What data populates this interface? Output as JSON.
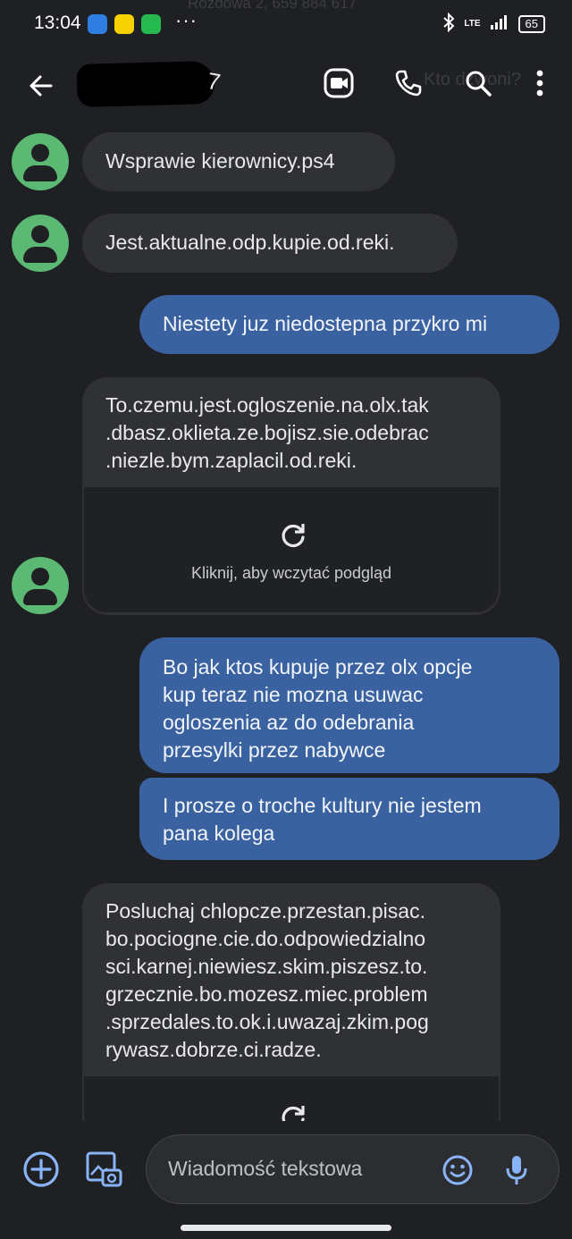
{
  "status_bar": {
    "time": "13:04",
    "dots": "···",
    "network": "LTE",
    "battery": "65",
    "background_caller_text": "Rozdowa 2, 659 884 617"
  },
  "app_bar": {
    "contact_name_suffix": "7",
    "background_search_text": "Kto dzwoni?",
    "icons": [
      "back-arrow-icon",
      "video-call-icon",
      "phone-icon",
      "search-icon",
      "more-vert-icon"
    ]
  },
  "messages": [
    {
      "dir": "in",
      "text": "Wsprawie kierownicy.ps4"
    },
    {
      "dir": "in",
      "text": "Jest.aktualne.odp.kupie.od.reki."
    },
    {
      "dir": "out",
      "text": "Niestety juz niedostepna przykro mi"
    },
    {
      "dir": "in",
      "text": "To.czemu.jest.ogloszenie.na.olx.tak\n.dbasz.oklieta.ze.bojisz.sie.odebrac\n.niezle.bym.zaplacil.od.reki.",
      "preview_label": "Kliknij, aby wczytać podgląd"
    },
    {
      "dir": "out",
      "text": "Bo jak ktos kupuje przez olx opcje\nkup teraz nie mozna usuwac\nogloszenia az do odebrania\nprzesylki przez nabywce"
    },
    {
      "dir": "out",
      "text": "I prosze o troche kultury nie jestem\npana kolega"
    },
    {
      "dir": "in",
      "text": "Posluchaj chlopcze.przestan.pisac.\nbo.pociogne.cie.do.odpowiedzialno\nsci.karnej.niewiesz.skim.piszesz.to.\ngrzecznie.bo.mozesz.miec.problem\n.sprzedales.to.ok.i.uwazaj.zkim.pog\nrywasz.dobrze.ci.radze."
    }
  ],
  "composer": {
    "placeholder": "Wiadomość tekstowa",
    "icons": [
      "add-circle-icon",
      "gallery-icon",
      "emoji-icon",
      "mic-icon"
    ]
  },
  "colors": {
    "background": "#1f2023",
    "incoming_bubble": "#303134",
    "outgoing_bubble": "#3a62a0",
    "avatar": "#5bb974",
    "accent_blue": "#8ab4f8"
  }
}
